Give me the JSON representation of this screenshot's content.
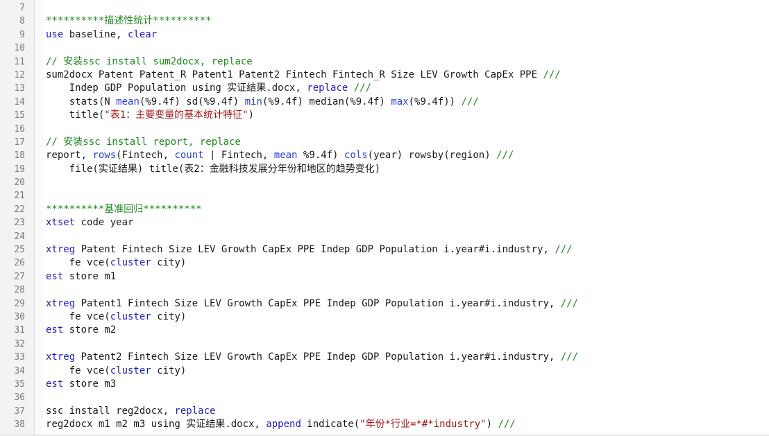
{
  "editor": {
    "lines": [
      {
        "num": "7",
        "tokens": []
      },
      {
        "num": "8",
        "tokens": [
          {
            "t": "**********描述性统计**********",
            "c": "com"
          }
        ]
      },
      {
        "num": "9",
        "tokens": [
          {
            "t": "use",
            "c": "kw"
          },
          {
            "t": " baseline, ",
            "c": "plain"
          },
          {
            "t": "clear",
            "c": "kw"
          }
        ]
      },
      {
        "num": "10",
        "tokens": []
      },
      {
        "num": "11",
        "tokens": [
          {
            "t": "// 安装ssc install sum2docx, replace",
            "c": "com"
          }
        ]
      },
      {
        "num": "12",
        "tokens": [
          {
            "t": "sum2docx Patent Patent_R Patent1 Patent2 Fintech Fintech_R Size LEV Growth CapEx PPE ",
            "c": "plain"
          },
          {
            "t": "///",
            "c": "com"
          }
        ]
      },
      {
        "num": "13",
        "tokens": [
          {
            "t": "    Indep GDP Population using 实证结果.docx, ",
            "c": "plain"
          },
          {
            "t": "replace",
            "c": "kw"
          },
          {
            "t": " ",
            "c": "plain"
          },
          {
            "t": "///",
            "c": "com"
          }
        ]
      },
      {
        "num": "14",
        "tokens": [
          {
            "t": "    stats(N ",
            "c": "plain"
          },
          {
            "t": "mean",
            "c": "func"
          },
          {
            "t": "(%9.4f) sd(%9.4f) ",
            "c": "plain"
          },
          {
            "t": "min",
            "c": "func"
          },
          {
            "t": "(%9.4f) median(%9.4f) ",
            "c": "plain"
          },
          {
            "t": "max",
            "c": "func"
          },
          {
            "t": "(%9.4f)) ",
            "c": "plain"
          },
          {
            "t": "///",
            "c": "com"
          }
        ]
      },
      {
        "num": "15",
        "tokens": [
          {
            "t": "    title(",
            "c": "plain"
          },
          {
            "t": "\"表1：主要变量的基本统计特征\"",
            "c": "str"
          },
          {
            "t": ")",
            "c": "plain"
          }
        ]
      },
      {
        "num": "16",
        "tokens": []
      },
      {
        "num": "17",
        "tokens": [
          {
            "t": "// 安装ssc install report, replace",
            "c": "com"
          }
        ]
      },
      {
        "num": "18",
        "tokens": [
          {
            "t": "report, ",
            "c": "plain"
          },
          {
            "t": "rows",
            "c": "func"
          },
          {
            "t": "(Fintech, ",
            "c": "plain"
          },
          {
            "t": "count",
            "c": "func"
          },
          {
            "t": " | Fintech, ",
            "c": "plain"
          },
          {
            "t": "mean",
            "c": "func"
          },
          {
            "t": " %9.4f) ",
            "c": "plain"
          },
          {
            "t": "cols",
            "c": "func"
          },
          {
            "t": "(year) rowsby(region) ",
            "c": "plain"
          },
          {
            "t": "///",
            "c": "com"
          }
        ]
      },
      {
        "num": "19",
        "tokens": [
          {
            "t": "    file(实证结果) title(表2：金融科技发展分年份和地区的趋势变化)",
            "c": "plain"
          }
        ]
      },
      {
        "num": "20",
        "tokens": []
      },
      {
        "num": "21",
        "tokens": []
      },
      {
        "num": "22",
        "tokens": [
          {
            "t": "**********基准回归**********",
            "c": "com"
          }
        ]
      },
      {
        "num": "23",
        "tokens": [
          {
            "t": "xtset",
            "c": "kw"
          },
          {
            "t": " code year",
            "c": "plain"
          }
        ]
      },
      {
        "num": "24",
        "tokens": []
      },
      {
        "num": "25",
        "tokens": [
          {
            "t": "xtreg",
            "c": "kw"
          },
          {
            "t": " Patent Fintech Size LEV Growth CapEx PPE Indep GDP Population i.year#i.industry, ",
            "c": "plain"
          },
          {
            "t": "///",
            "c": "com"
          }
        ]
      },
      {
        "num": "26",
        "tokens": [
          {
            "t": "    fe vce(",
            "c": "plain"
          },
          {
            "t": "cluster",
            "c": "kw"
          },
          {
            "t": " city)",
            "c": "plain"
          }
        ]
      },
      {
        "num": "27",
        "tokens": [
          {
            "t": "est",
            "c": "kw"
          },
          {
            "t": " store m1",
            "c": "plain"
          }
        ]
      },
      {
        "num": "28",
        "tokens": []
      },
      {
        "num": "29",
        "tokens": [
          {
            "t": "xtreg",
            "c": "kw"
          },
          {
            "t": " Patent1 Fintech Size LEV Growth CapEx PPE Indep GDP Population i.year#i.industry, ",
            "c": "plain"
          },
          {
            "t": "///",
            "c": "com"
          }
        ]
      },
      {
        "num": "30",
        "tokens": [
          {
            "t": "    fe vce(",
            "c": "plain"
          },
          {
            "t": "cluster",
            "c": "kw"
          },
          {
            "t": " city)",
            "c": "plain"
          }
        ]
      },
      {
        "num": "31",
        "tokens": [
          {
            "t": "est",
            "c": "kw"
          },
          {
            "t": " store m2",
            "c": "plain"
          }
        ]
      },
      {
        "num": "32",
        "tokens": []
      },
      {
        "num": "33",
        "tokens": [
          {
            "t": "xtreg",
            "c": "kw"
          },
          {
            "t": " Patent2 Fintech Size LEV Growth CapEx PPE Indep GDP Population i.year#i.industry, ",
            "c": "plain"
          },
          {
            "t": "///",
            "c": "com"
          }
        ]
      },
      {
        "num": "34",
        "tokens": [
          {
            "t": "    fe vce(",
            "c": "plain"
          },
          {
            "t": "cluster",
            "c": "kw"
          },
          {
            "t": " city)",
            "c": "plain"
          }
        ]
      },
      {
        "num": "35",
        "tokens": [
          {
            "t": "est",
            "c": "kw"
          },
          {
            "t": " store m3",
            "c": "plain"
          }
        ]
      },
      {
        "num": "36",
        "tokens": []
      },
      {
        "num": "37",
        "tokens": [
          {
            "t": "ssc install reg2docx, ",
            "c": "plain"
          },
          {
            "t": "replace",
            "c": "kw"
          }
        ]
      },
      {
        "num": "38",
        "tokens": [
          {
            "t": "reg2docx m1 m2 m3 using 实证结果.docx, ",
            "c": "plain"
          },
          {
            "t": "append",
            "c": "kw"
          },
          {
            "t": " indicate(",
            "c": "plain"
          },
          {
            "t": "\"年份*行业=*#*industry\"",
            "c": "str"
          },
          {
            "t": ") ",
            "c": "plain"
          },
          {
            "t": "///",
            "c": "com"
          }
        ]
      }
    ]
  },
  "colors": {
    "keyword": "#1f1fbf",
    "function": "#2a3fd6",
    "comment": "#1b8a1b",
    "string": "#a31515",
    "plain": "#1a1a1a",
    "line_number": "#7a7a7a",
    "gutter_bg": "#f3f3f3"
  }
}
